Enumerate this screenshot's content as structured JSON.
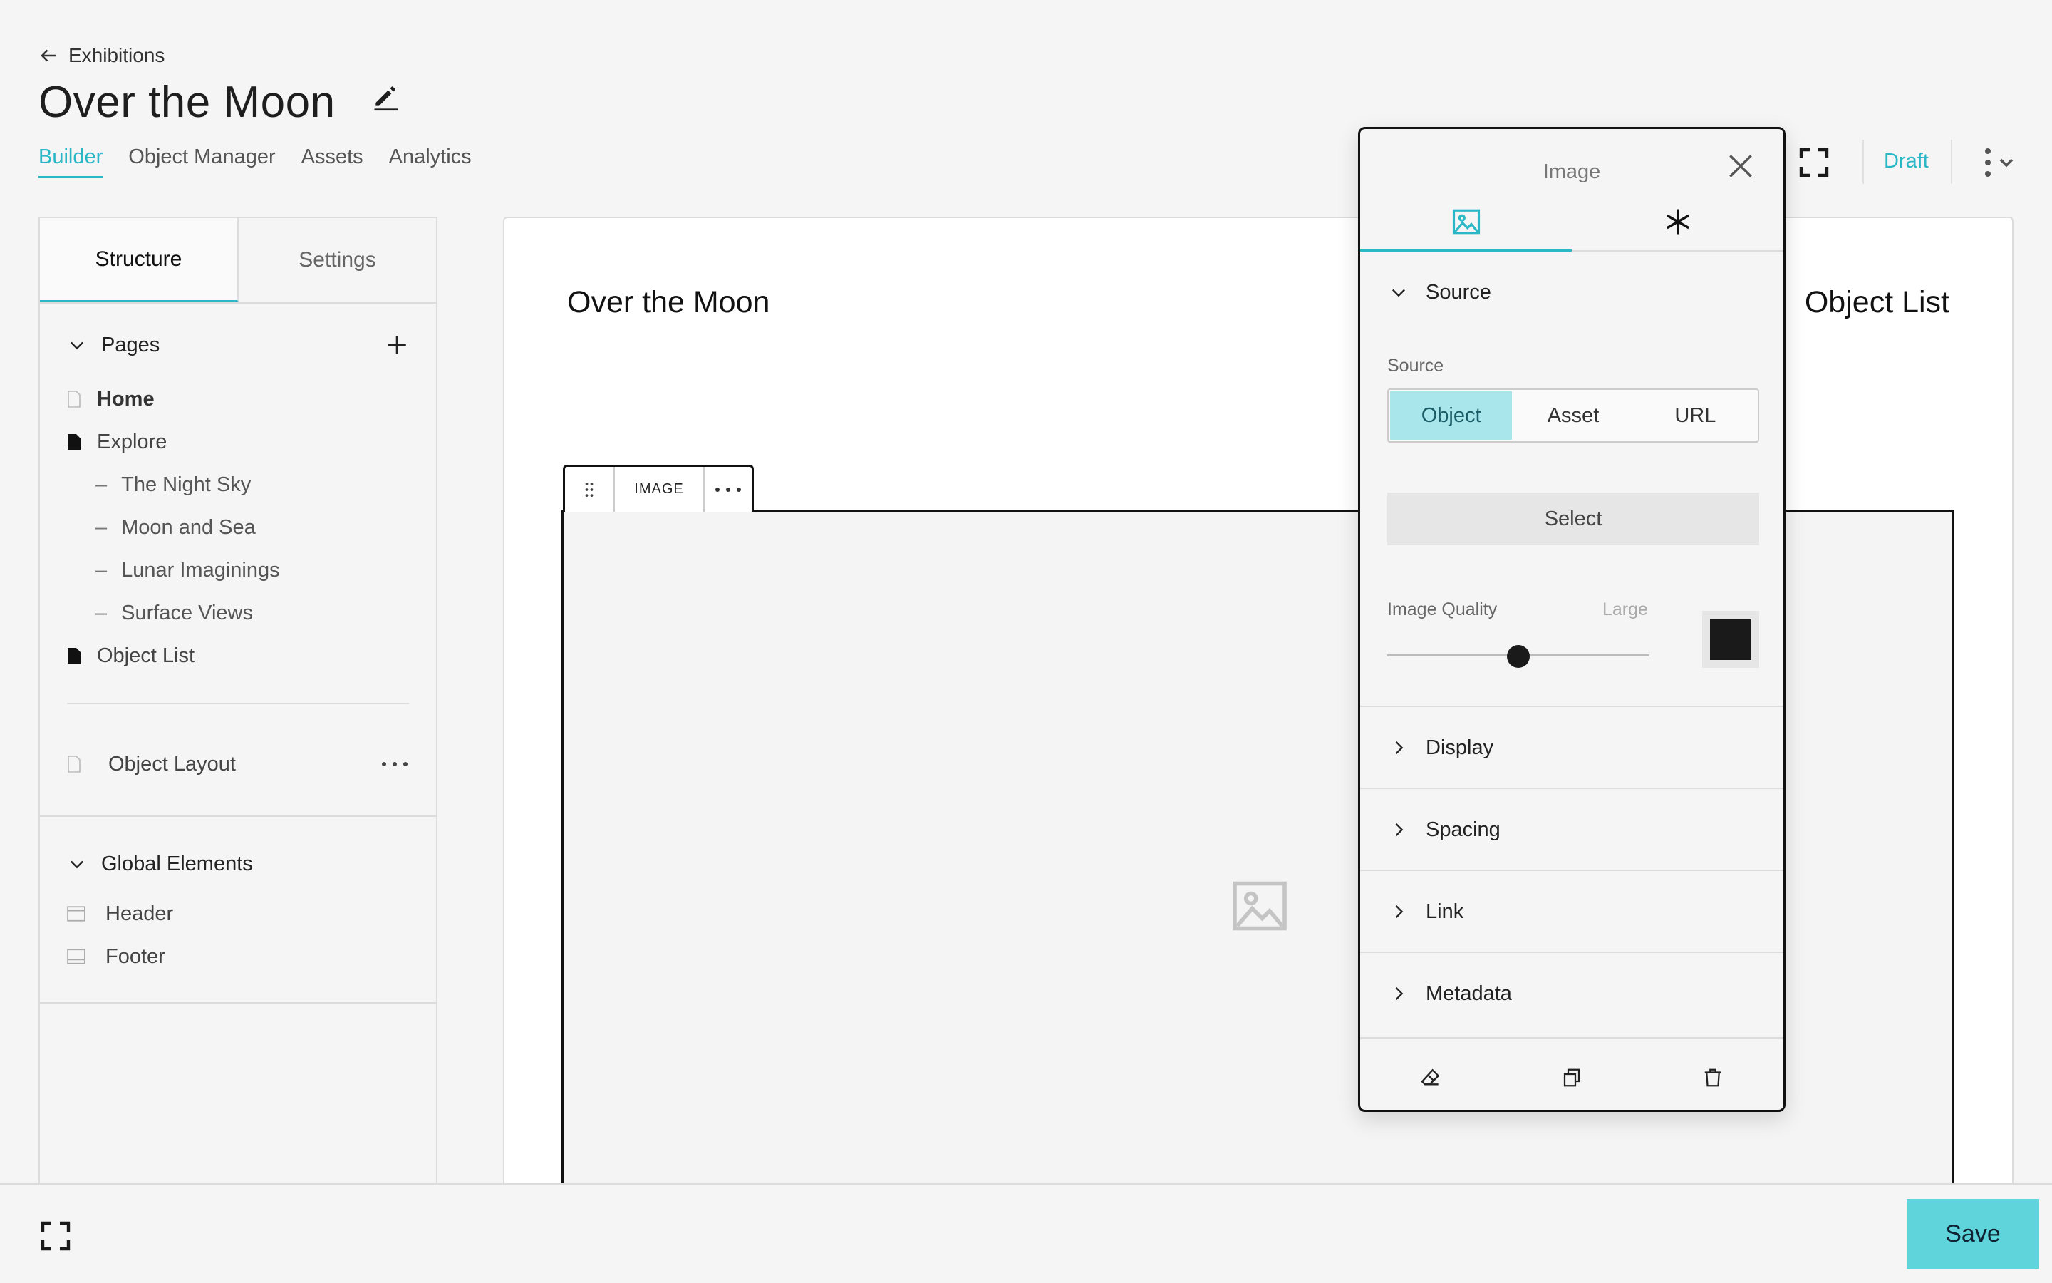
{
  "header": {
    "back_label": "Exhibitions",
    "title": "Over the Moon",
    "tabs": [
      "Builder",
      "Object Manager",
      "Assets",
      "Analytics"
    ],
    "status": "Draft"
  },
  "left_panel": {
    "tabs": [
      "Structure",
      "Settings"
    ],
    "pages_label": "Pages",
    "pages": {
      "home": "Home",
      "explore": "Explore",
      "explore_children": [
        "The Night Sky",
        "Moon and Sea",
        "Lunar Imaginings",
        "Surface Views"
      ],
      "object_list": "Object List"
    },
    "object_layout": "Object Layout",
    "global_label": "Global Elements",
    "global_items": [
      "Header",
      "Footer"
    ]
  },
  "canvas": {
    "left_title": "Over the Moon",
    "right_title": "Object List",
    "toolbar_label": "IMAGE"
  },
  "popover": {
    "title": "Image",
    "source_section": "Source",
    "source_field_label": "Source",
    "source_options": [
      "Object",
      "Asset",
      "URL"
    ],
    "source_selected": "Object",
    "select_label": "Select",
    "quality_label": "Image Quality",
    "quality_value": "Large",
    "quality_level": 0.5,
    "swatch_color": "#1a1a1a",
    "sections": [
      "Display",
      "Spacing",
      "Link",
      "Metadata"
    ]
  },
  "footer": {
    "save_label": "Save"
  },
  "colors": {
    "accent": "#2ab8c6",
    "save": "#5fd4da",
    "segment_active": "#a8e6ec"
  }
}
